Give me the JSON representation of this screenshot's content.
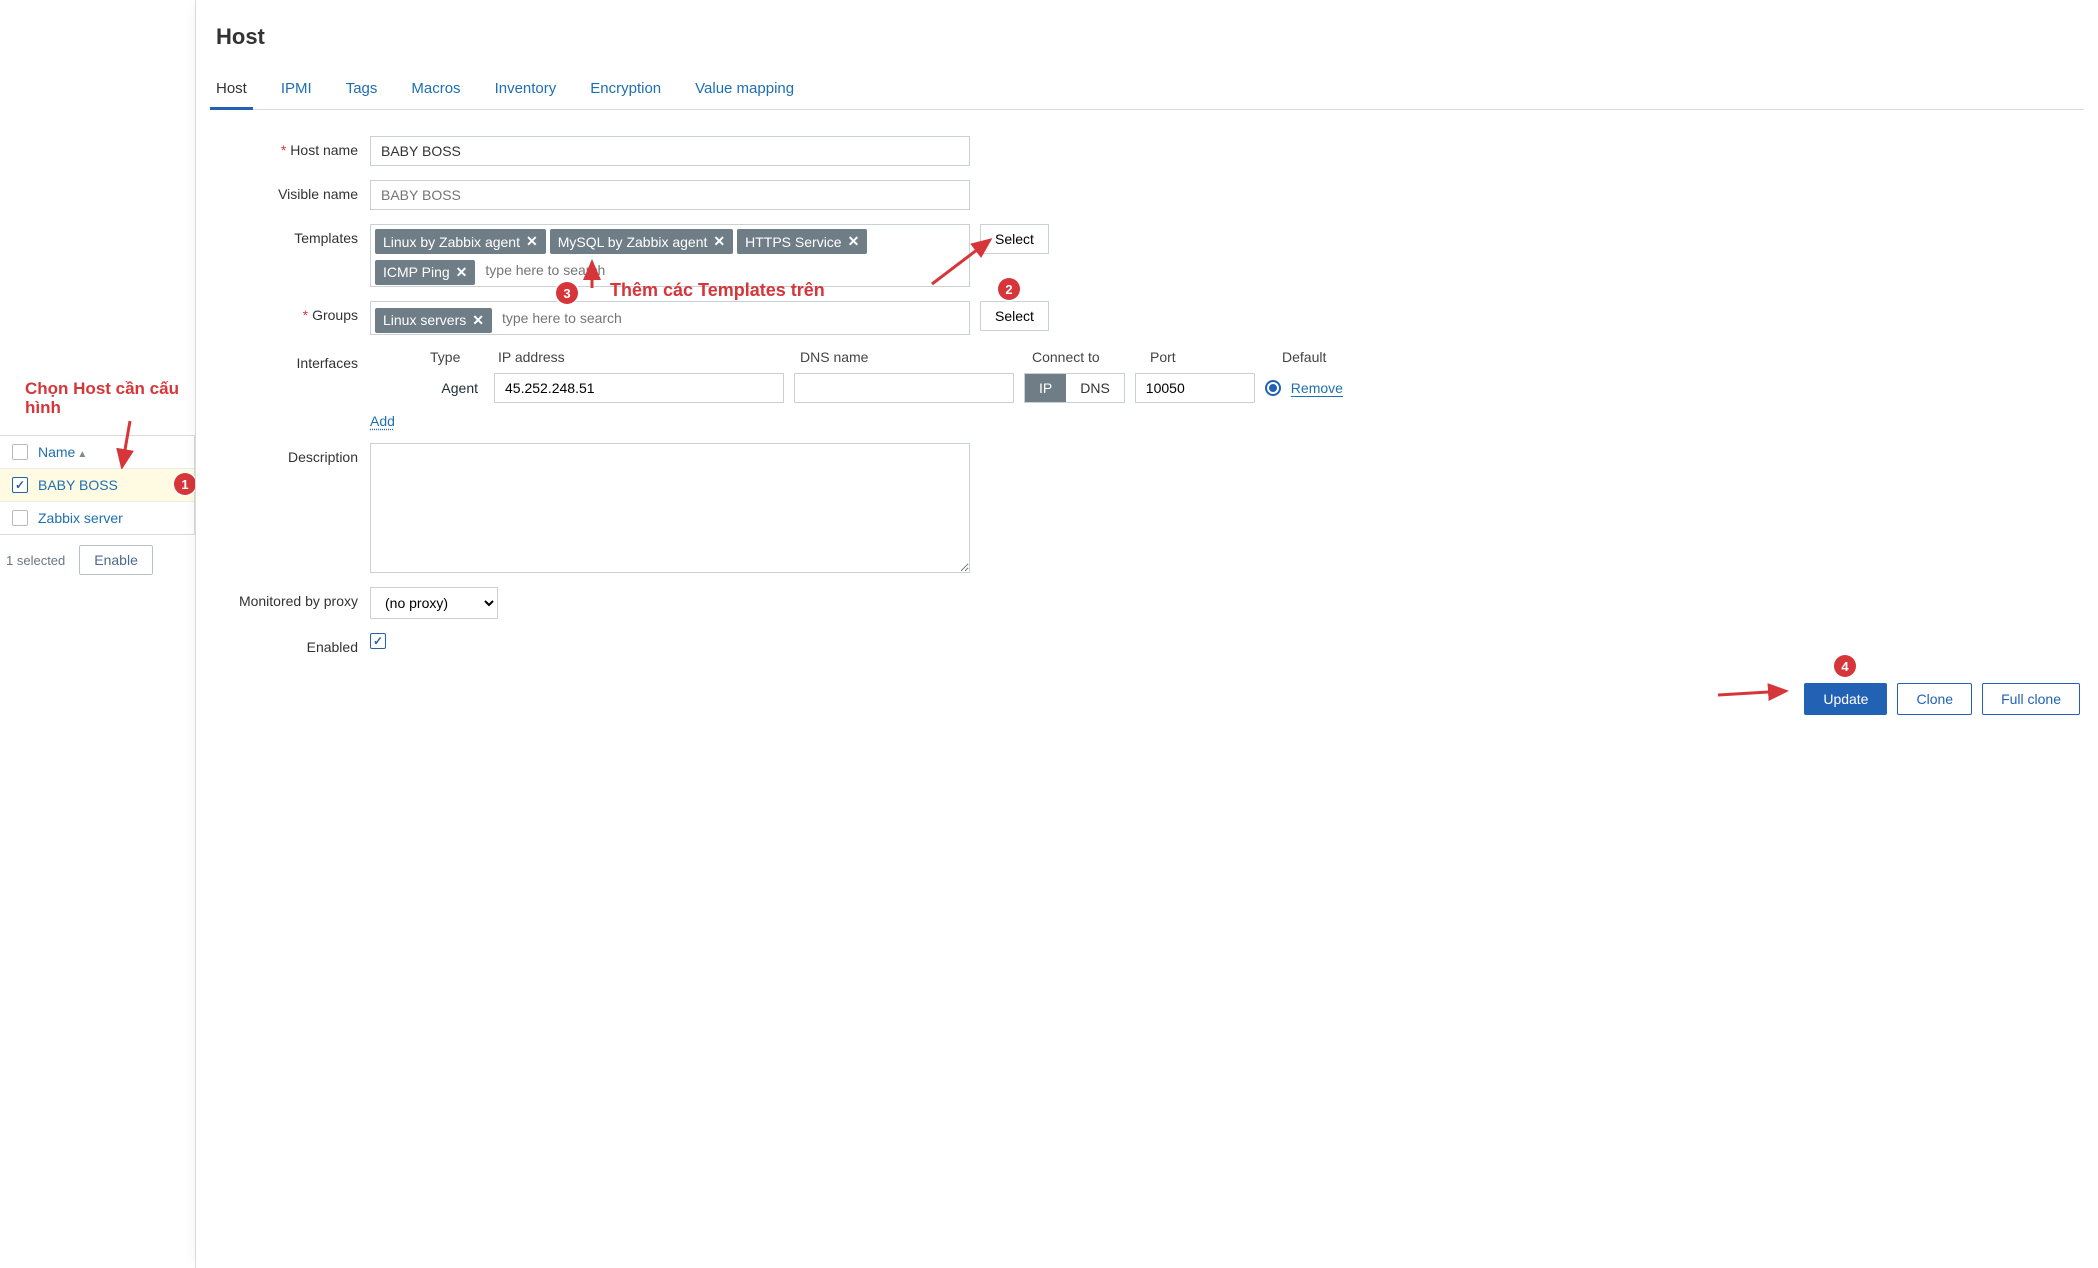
{
  "dialog_title": "Host",
  "tabs": [
    "Host",
    "IPMI",
    "Tags",
    "Macros",
    "Inventory",
    "Encryption",
    "Value mapping"
  ],
  "form": {
    "hostname_label": "Host name",
    "hostname_value": "BABY BOSS",
    "visiblename_label": "Visible name",
    "visiblename_placeholder": "BABY BOSS",
    "templates_label": "Templates",
    "template_tags": [
      "Linux by Zabbix agent",
      "MySQL by Zabbix agent",
      "HTTPS Service",
      "ICMP Ping"
    ],
    "templates_search_placeholder": "type here to search",
    "groups_label": "Groups",
    "group_tags": [
      "Linux servers"
    ],
    "groups_search_placeholder": "type here to search",
    "select_btn": "Select",
    "interfaces_label": "Interfaces",
    "iface_headers": {
      "type": "Type",
      "ip": "IP address",
      "dns": "DNS name",
      "connect": "Connect to",
      "port": "Port",
      "default": "Default"
    },
    "iface_row": {
      "agent": "Agent",
      "ip": "45.252.248.51",
      "dns": "",
      "ip_label": "IP",
      "dns_label": "DNS",
      "port": "10050",
      "remove": "Remove"
    },
    "add_link": "Add",
    "description_label": "Description",
    "proxy_label": "Monitored by proxy",
    "proxy_value": "(no proxy)",
    "enabled_label": "Enabled"
  },
  "sidebar": {
    "name_header": "Name",
    "hosts": [
      {
        "name": "BABY BOSS",
        "selected": true
      },
      {
        "name": "Zabbix server",
        "selected": false
      }
    ],
    "selection_text": "1 selected",
    "enable_btn": "Enable"
  },
  "annotations": {
    "a1": "Chọn Host cần cấu hình",
    "templates_note": "Thêm các Templates trên",
    "n1": "1",
    "n2": "2",
    "n3": "3",
    "n4": "4"
  },
  "footer_buttons": {
    "update": "Update",
    "clone": "Clone",
    "fullclone": "Full clone"
  }
}
